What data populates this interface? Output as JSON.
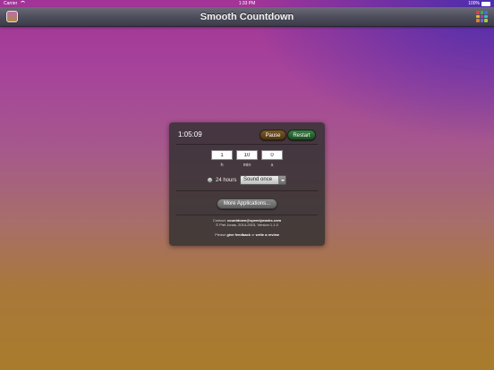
{
  "status_bar": {
    "carrier": "Carrier",
    "time": "1:33 PM",
    "battery": "100%"
  },
  "nav": {
    "title": "Smooth Countdown"
  },
  "timer": {
    "display": "1:05:09",
    "pause_label": "Pause",
    "restart_label": "Restart",
    "hours_value": "1",
    "minutes_value": "10",
    "seconds_value": "0",
    "hours_unit": "h",
    "minutes_unit": "min",
    "seconds_unit": "s",
    "hours24_label": "24 hours",
    "sound_value": "Sound once"
  },
  "more_apps_label": "More Applications...",
  "footer": {
    "contact_prefix": "Contact: ",
    "contact_email": "countdown@speedymarks.com",
    "copyright": "© Piet Jonas, 2014-2015, Version 1.1.0",
    "please_prefix": "Please ",
    "feedback_link": "give feedback",
    "or_text": " or ",
    "review_link": "write a review"
  },
  "colors": {
    "pause_button": "#5a3d14",
    "restart_button": "#2a6232",
    "grid_icon": [
      "#e04040",
      "#40b040",
      "#4070e0",
      "#e0c030",
      "#b040c0",
      "#40c0c0",
      "#e08030",
      "#8060e0",
      "#a0d040"
    ]
  }
}
